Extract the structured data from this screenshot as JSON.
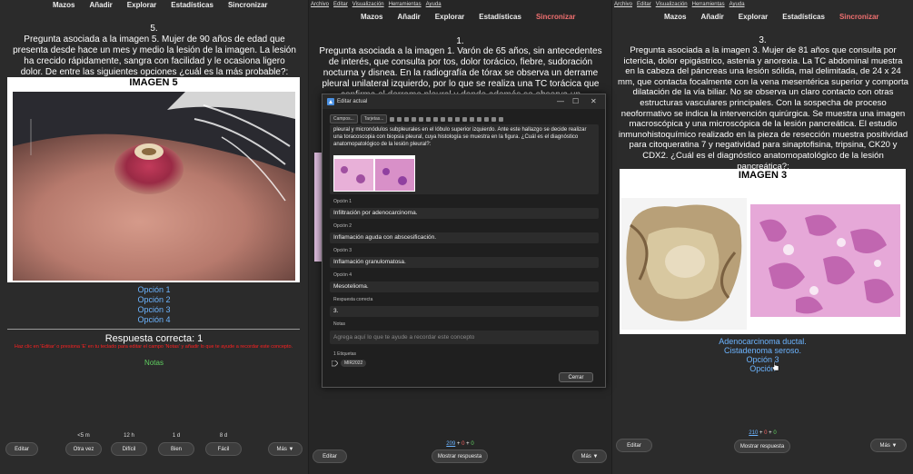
{
  "nav": {
    "decks": "Mazos",
    "add": "Añadir",
    "browse": "Explorar",
    "stats": "Estadísticas",
    "sync": "Sincronizar"
  },
  "menu": {
    "file": "Archivo",
    "edit": "Editar",
    "view": "Visualización",
    "tools": "Herramientas",
    "help": "Ayuda"
  },
  "card1": {
    "number": "5.",
    "question": "Pregunta asociada a la imagen 5. Mujer de 90 años de edad que presenta desde hace un mes y medio la lesión de la imagen. La lesión ha crecido rápidamente, sangra con facilidad y le ocasiona ligero dolor. De entre las siguientes opciones ¿cuál es la más probable?:",
    "image_title": "IMAGEN 5",
    "options": [
      "Opción 1",
      "Opción 2",
      "Opción 3",
      "Opción 4"
    ],
    "answer": "Respuesta correcta: 1",
    "hint": "Haz clic en 'Editar' o presiona 'E' en tu teclado para editar el campo 'Notas' y añadir lo que te ayude a recordar este concepto.",
    "notes": "Notas",
    "intervals": [
      "<5 m",
      "12 h",
      "1 d",
      "8 d"
    ],
    "buttons": {
      "edit": "Editar",
      "again": "Otra vez",
      "hard": "Difícil",
      "good": "Bien",
      "easy": "Fácil",
      "more": "Más ▼"
    }
  },
  "card2": {
    "number": "1.",
    "question": "Pregunta asociada a la imagen 1. Varón de 65 años, sin antecedentes de interés, que consulta por tos, dolor torácico, fiebre, sudoración nocturna y disnea. En la radiografía de tórax se observa un derrame pleural unilateral izquierdo, por lo que se realiza una TC torácica que confirma el derrame pleural y donde además se observa un",
    "counts": {
      "new": "209",
      "sep1": " + ",
      "learn": "0",
      "sep2": " + ",
      "review": "0"
    },
    "buttons": {
      "edit": "Editar",
      "show": "Mostrar respuesta",
      "more": "Más ▼"
    }
  },
  "dialog": {
    "title": "Editar actual",
    "toolbar": {
      "fields": "Campos...",
      "cards": "Tarjetas..."
    },
    "front_text": "pleural y micronódulos subpleurales en el lóbulo superior izquierdo. Ante este hallazgo se decide realizar una toracoscopia con biopsia pleural, cuya histología se muestra en la figura. ¿Cuál es el diagnóstico anatomopatológico de la lesión pleural?:",
    "fields": [
      {
        "label": "Opción 1",
        "value": "Infiltración por adenocarcinoma."
      },
      {
        "label": "Opción 2",
        "value": "Inflamación aguda con abscesificación."
      },
      {
        "label": "Opción 3",
        "value": "Inflamación granulomatosa."
      },
      {
        "label": "Opción 4",
        "value": "Mesotelioma."
      },
      {
        "label": "Respuesta correcta",
        "value": "3."
      }
    ],
    "notes_label": "Notas",
    "notes_placeholder": "Agrega aquí lo que te ayude a recordar este concepto",
    "tags_label": "1 Etiquetas",
    "tag": "MIR2022",
    "close": "Cerrar"
  },
  "card3": {
    "number": "3.",
    "question": "Pregunta asociada a la imagen 3. Mujer de 81 años que consulta por ictericia, dolor epigástrico, astenia y anorexia. La TC abdominal muestra en la cabeza del páncreas una lesión sólida, mal delimitada, de 24 x 24 mm, que contacta focalmente con la vena mesentérica superior y comporta dilatación de la vía biliar. No se observa un claro contacto con otras estructuras vasculares principales. Con la sospecha de proceso neoformativo se indica la intervención quirúrgica. Se muestra una imagen macroscópica y una microscópica de la lesión pancreática. El estudio inmunohistoquímico realizado en la pieza de resección muestra positividad para citoqueratina 7 y negatividad para sinaptofisina, tripsina, CK20 y CDX2. ¿Cuál es el diagnóstico anatomopatológico de la lesión pancreática?:",
    "image_title": "IMAGEN 3",
    "options": [
      "Adenocarcinoma ductal.",
      "Cistadenoma seroso.",
      "Opción 3",
      "Opción"
    ],
    "counts": {
      "new": "210",
      "sep1": " + ",
      "learn": "0",
      "sep2": " + ",
      "review": "0"
    },
    "buttons": {
      "edit": "Editar",
      "show": "Mostrar respuesta",
      "more": "Más ▼"
    }
  },
  "colors": {
    "link": "#6cb4ff",
    "sync": "#f07070",
    "hint": "#ff2020",
    "notes": "#60d060"
  }
}
